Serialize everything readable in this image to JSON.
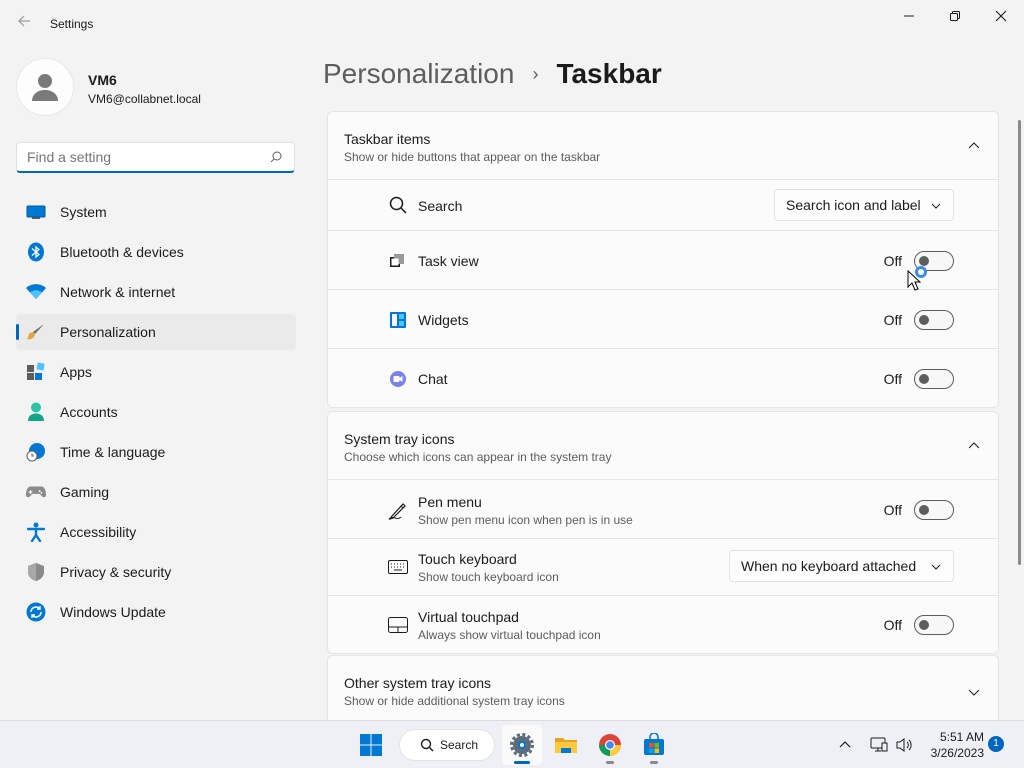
{
  "window": {
    "title": "Settings"
  },
  "profile": {
    "name": "VM6",
    "email": "VM6@collabnet.local"
  },
  "search": {
    "placeholder": "Find a setting"
  },
  "nav": {
    "items": [
      {
        "label": "System",
        "icon": "display-icon"
      },
      {
        "label": "Bluetooth & devices",
        "icon": "bluetooth-icon"
      },
      {
        "label": "Network & internet",
        "icon": "wifi-icon"
      },
      {
        "label": "Personalization",
        "icon": "brush-icon",
        "active": true
      },
      {
        "label": "Apps",
        "icon": "apps-icon"
      },
      {
        "label": "Accounts",
        "icon": "person-icon"
      },
      {
        "label": "Time & language",
        "icon": "clock-globe-icon"
      },
      {
        "label": "Gaming",
        "icon": "gamepad-icon"
      },
      {
        "label": "Accessibility",
        "icon": "accessibility-icon"
      },
      {
        "label": "Privacy & security",
        "icon": "shield-icon"
      },
      {
        "label": "Windows Update",
        "icon": "update-icon"
      }
    ]
  },
  "breadcrumb": {
    "parent": "Personalization",
    "separator": "›",
    "current": "Taskbar"
  },
  "taskbar_items": {
    "title": "Taskbar items",
    "subtitle": "Show or hide buttons that appear on the taskbar",
    "rows": [
      {
        "label": "Search",
        "control": "dropdown",
        "value": "Search icon and label"
      },
      {
        "label": "Task view",
        "control": "toggle",
        "state": "Off"
      },
      {
        "label": "Widgets",
        "control": "toggle",
        "state": "Off"
      },
      {
        "label": "Chat",
        "control": "toggle",
        "state": "Off"
      }
    ]
  },
  "system_tray": {
    "title": "System tray icons",
    "subtitle": "Choose which icons can appear in the system tray",
    "rows": [
      {
        "label": "Pen menu",
        "sub": "Show pen menu icon when pen is in use",
        "control": "toggle",
        "state": "Off"
      },
      {
        "label": "Touch keyboard",
        "sub": "Show touch keyboard icon",
        "control": "dropdown",
        "value": "When no keyboard attached"
      },
      {
        "label": "Virtual touchpad",
        "sub": "Always show virtual touchpad icon",
        "control": "toggle",
        "state": "Off"
      }
    ]
  },
  "other_tray": {
    "title": "Other system tray icons",
    "subtitle": "Show or hide additional system tray icons"
  },
  "taskbar": {
    "search_label": "Search",
    "time": "5:51 AM",
    "date": "3/26/2023",
    "notification_count": "1"
  },
  "colors": {
    "accent": "#0067c0",
    "background": "#f3f3f3",
    "card": "#fbfbfb"
  }
}
